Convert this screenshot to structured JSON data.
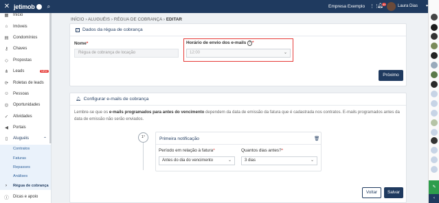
{
  "topbar": {
    "close_icon": "close-icon",
    "logo_text": "jetimob",
    "company": "Empresa Exemplo",
    "notifications_count": "99",
    "user_name": "Laura Dias"
  },
  "sidebar": {
    "items": [
      {
        "label": "Início",
        "icon": "grid-icon"
      },
      {
        "label": "Imóveis",
        "icon": "home-icon"
      },
      {
        "label": "Condomínios",
        "icon": "building-icon"
      },
      {
        "label": "Chaves",
        "icon": "key-icon"
      },
      {
        "label": "Propostas",
        "icon": "tag-icon"
      },
      {
        "label": "Leads",
        "icon": "share-icon",
        "badge": "NEW"
      },
      {
        "label": "Roletas de leads",
        "icon": "roulette-icon"
      },
      {
        "label": "Pessoas",
        "icon": "people-icon"
      },
      {
        "label": "Oportunidades",
        "icon": "target-icon"
      },
      {
        "label": "Atividades",
        "icon": "check-circle-icon"
      },
      {
        "label": "Portais",
        "icon": "megaphone-icon"
      },
      {
        "label": "Aluguéis",
        "icon": "doc-icon"
      }
    ],
    "sub_items": [
      "Contratos",
      "Faturas",
      "Repasses",
      "Análises",
      "Régua de cobrança"
    ],
    "footer_item": "Dicas e apoio"
  },
  "breadcrumb": {
    "a": "INÍCIO",
    "b": "ALUGUÉIS",
    "c": "RÉGUA DE COBRANÇA",
    "d": "EDITAR"
  },
  "card1": {
    "title": "Dados da régua de cobrança",
    "name_label": "Nome",
    "name_placeholder": "Régua de cobrança de locação",
    "time_label": "Horário de envio dos e-mails",
    "time_placeholder": "12:00",
    "next_button": "Próximo"
  },
  "card2": {
    "title": "Configurar e-mails de cobrança",
    "note_pre": "Lembre-se que os ",
    "note_bold": "e-mails programados para antes do vencimento",
    "note_post": " dependem da data de emissão da fatura que é cadastrada nos contratos. E-mails programados antes da data de emissão não serão enviados.",
    "step_label": "1°",
    "notif_title": "Primeira notificação",
    "period_label": "Período em relação à fatura",
    "period_value": "Antes do dia do vencimento",
    "days_label": "Quantos dias antes?",
    "days_value": "3 dias",
    "back_button": "Voltar",
    "save_button": "Salvar"
  }
}
